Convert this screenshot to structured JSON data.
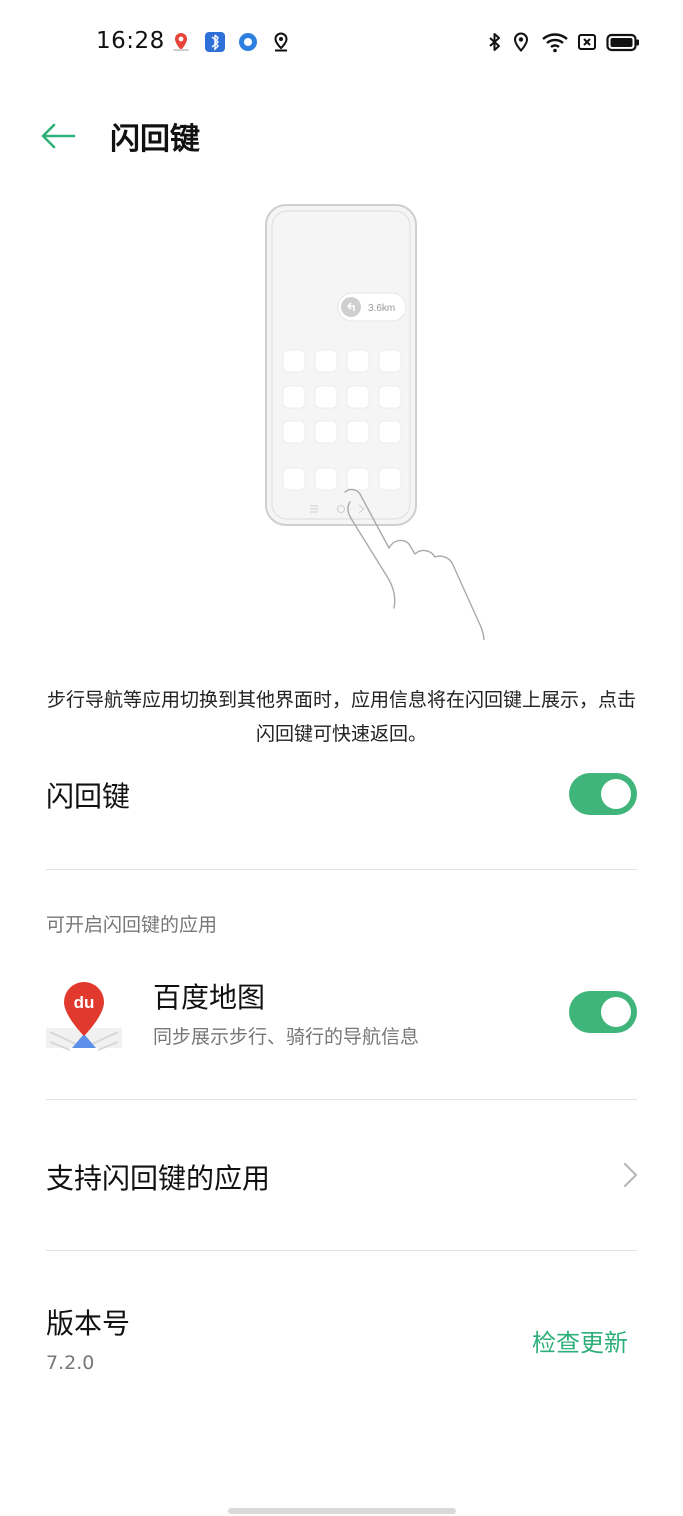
{
  "status_bar": {
    "time": "16:28",
    "left_icons": [
      "map-pin-app-icon",
      "bluetooth-app-icon",
      "circle-app-icon",
      "location-icon"
    ],
    "right_icons": [
      "bluetooth-icon",
      "location-icon",
      "wifi-icon",
      "sim-icon",
      "battery-icon"
    ]
  },
  "header": {
    "title": "闪回键"
  },
  "illustration": {
    "distance": "3.6km"
  },
  "description": "步行导航等应用切换到其他界面时，应用信息将在闪回键上展示，点击闪回键可快速返回。",
  "main_toggle": {
    "label": "闪回键",
    "on": true
  },
  "apps_section": {
    "label": "可开启闪回键的应用",
    "apps": [
      {
        "name": "百度地图",
        "subtitle": "同步展示步行、骑行的导航信息",
        "icon": "baidu-map-icon",
        "icon_text": "du",
        "on": true
      }
    ]
  },
  "supported_apps": {
    "label": "支持闪回键的应用"
  },
  "version": {
    "label": "版本号",
    "value": "7.2.0",
    "check_update": "检查更新"
  },
  "colors": {
    "accent": "#3fb57b",
    "accent_text": "#2fb07a"
  }
}
